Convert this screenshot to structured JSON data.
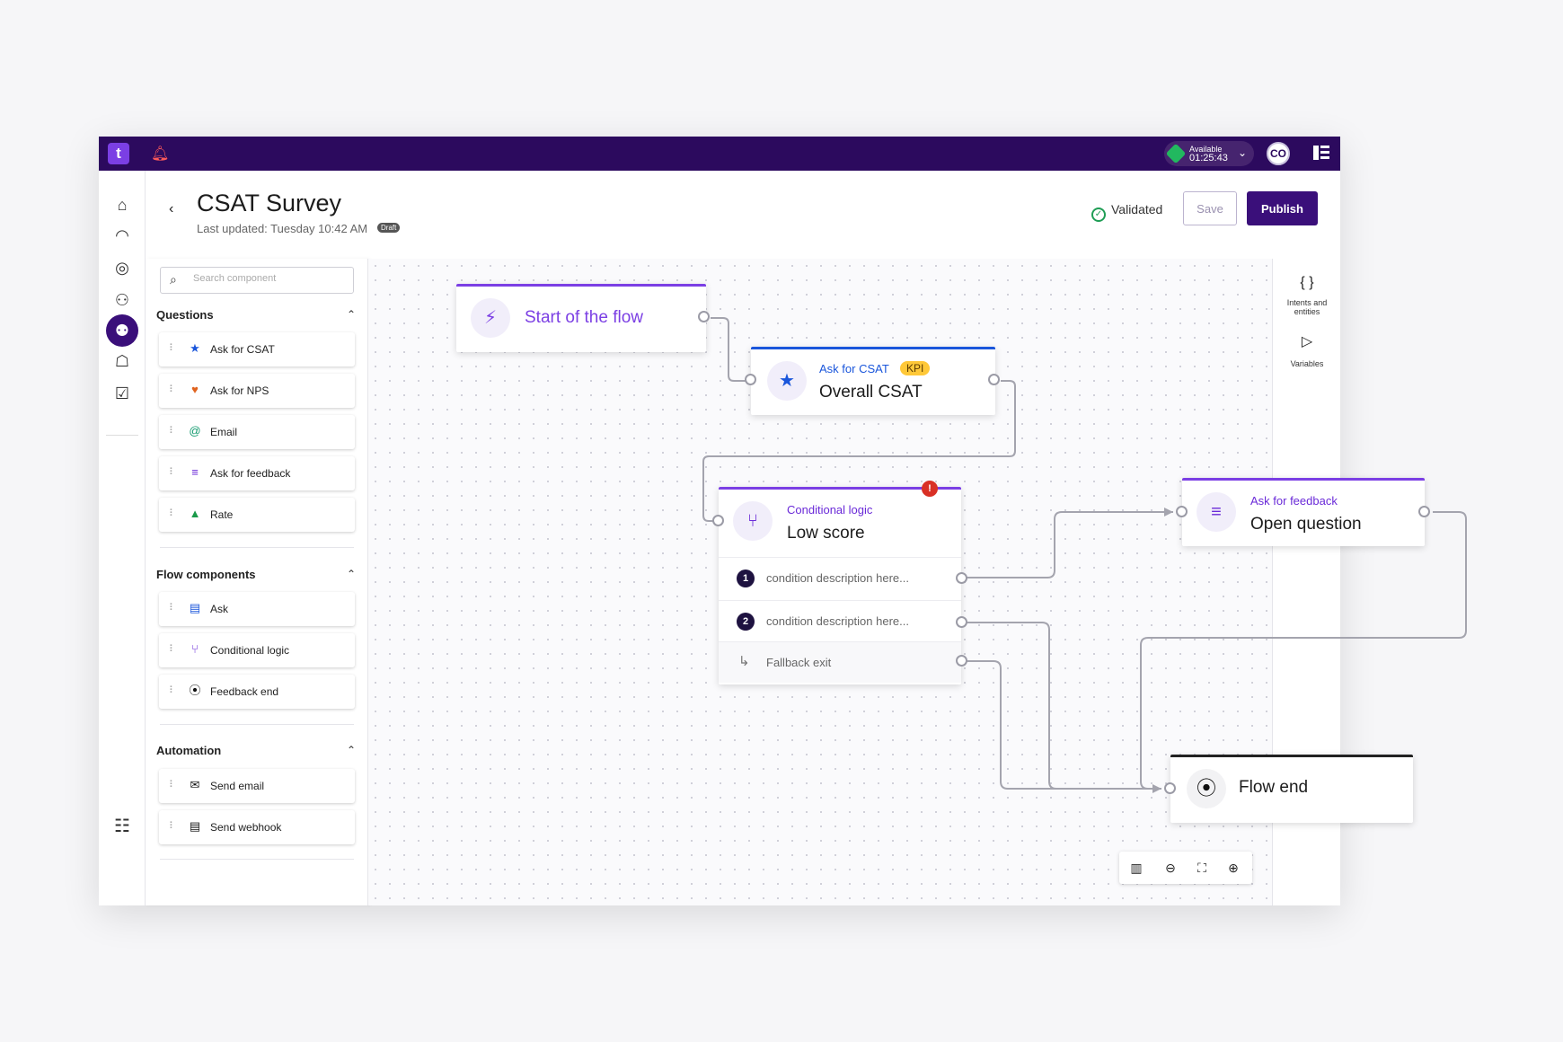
{
  "topbar": {
    "logo": "t",
    "status_label": "Available",
    "status_time": "01:25:43",
    "avatar_initials": "CO"
  },
  "header": {
    "title": "CSAT Survey",
    "last_updated": "Last updated: Tuesday 10:42 AM",
    "draft_badge": "Draft",
    "validated": "Validated",
    "save_label": "Save",
    "publish_label": "Publish"
  },
  "palette": {
    "search_placeholder": "Search component",
    "sections": [
      {
        "title": "Questions",
        "items": [
          {
            "label": "Ask for CSAT",
            "icon": "star-icon"
          },
          {
            "label": "Ask for NPS",
            "icon": "heart-icon"
          },
          {
            "label": "Email",
            "icon": "at-icon"
          },
          {
            "label": "Ask for feedback",
            "icon": "lines-icon"
          },
          {
            "label": "Rate",
            "icon": "thumbs-up-icon"
          }
        ]
      },
      {
        "title": "Flow components",
        "items": [
          {
            "label": "Ask",
            "icon": "chat-icon"
          },
          {
            "label": "Conditional logic",
            "icon": "branch-icon"
          },
          {
            "label": "Feedback end",
            "icon": "stop-icon"
          }
        ]
      },
      {
        "title": "Automation",
        "items": [
          {
            "label": "Send email",
            "icon": "mail-icon"
          },
          {
            "label": "Send webhook",
            "icon": "webhook-icon"
          }
        ]
      }
    ]
  },
  "rightbar": {
    "intents_label": "Intents and entities",
    "variables_label": "Variables"
  },
  "nodes": {
    "start": {
      "title": "Start of the flow"
    },
    "csat": {
      "subtitle": "Ask for CSAT",
      "badge": "KPI",
      "title": "Overall CSAT"
    },
    "conditional": {
      "subtitle": "Conditional logic",
      "title": "Low score",
      "rows": [
        {
          "num": "1",
          "text": "condition description here..."
        },
        {
          "num": "2",
          "text": "condition description here..."
        }
      ],
      "fallback": "Fallback exit",
      "error": "!"
    },
    "feedback": {
      "subtitle": "Ask for feedback",
      "title": "Open question"
    },
    "end": {
      "title": "Flow end"
    }
  },
  "colors": {
    "topbar": "#2c0a5e",
    "accent": "#3a0f7a",
    "purple": "#6a2ad8",
    "csat_blue": "#1a56db",
    "kpi": "#ffc838",
    "success": "#1f9d55",
    "error": "#d93025"
  }
}
